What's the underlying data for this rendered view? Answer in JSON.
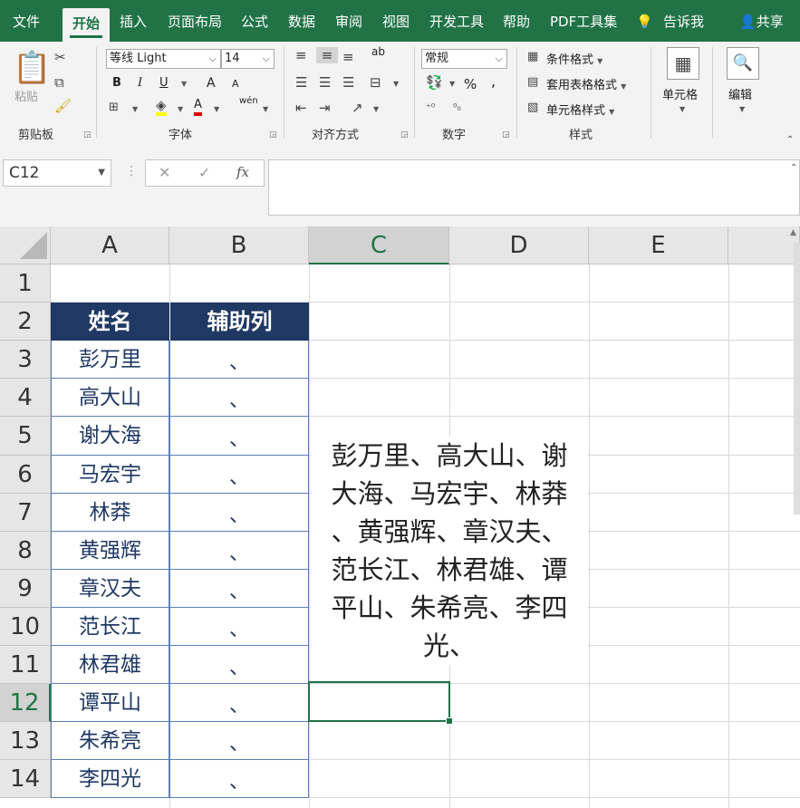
{
  "tabs": [
    {
      "label": "文件",
      "x": 14
    },
    {
      "label": "开始",
      "active": true
    },
    {
      "label": "插入"
    },
    {
      "label": "页面布局"
    },
    {
      "label": "公式"
    },
    {
      "label": "数据"
    },
    {
      "label": "审阅"
    },
    {
      "label": "视图"
    },
    {
      "label": "开发工具"
    },
    {
      "label": "帮助"
    },
    {
      "label": "PDF工具集"
    },
    {
      "label": "告诉我"
    },
    {
      "label": "共享"
    }
  ],
  "ribbon": {
    "clipboard": {
      "paste": "粘贴",
      "group": "剪贴板"
    },
    "font": {
      "name": "等线 Light",
      "size": "14",
      "bold": "B",
      "italic": "I",
      "underline": "U",
      "grow": "A",
      "shrink": "A",
      "phonetic": "wén",
      "group": "字体"
    },
    "alignment": {
      "group": "对齐方式",
      "wrap": "ab"
    },
    "number": {
      "format": "常规",
      "percent": "%",
      "comma": ",",
      "group": "数字"
    },
    "styles": {
      "conditional": "条件格式",
      "table": "套用表格格式",
      "cell": "单元格样式",
      "group": "样式"
    },
    "cells": {
      "label": "单元格"
    },
    "editing": {
      "label": "编辑"
    }
  },
  "formula_bar": {
    "name_box": "C12",
    "cancel": "✕",
    "enter": "✓",
    "fx": "fx",
    "content": ""
  },
  "columns": [
    "A",
    "B",
    "C",
    "D",
    "E"
  ],
  "rows": [
    "1",
    "2",
    "3",
    "4",
    "5",
    "6",
    "7",
    "8",
    "9",
    "10",
    "11",
    "12",
    "13",
    "14"
  ],
  "selected": {
    "column": "C",
    "row": "12"
  },
  "table": {
    "headers": [
      "姓名",
      "辅助列"
    ],
    "names": [
      "彭万里",
      "高大山",
      "谢大海",
      "马宏宇",
      "林莽",
      "黄强辉",
      "章汉夫",
      "范长江",
      "林君雄",
      "谭平山",
      "朱希亮",
      "李四光"
    ],
    "aux": [
      "、",
      "、",
      "、",
      "、",
      "、",
      "、",
      "、",
      "、",
      "、",
      "、",
      "、",
      "、"
    ]
  },
  "merged_cell_text": [
    "彭万里、高大山、谢",
    "大海、马宏宇、林莽",
    "、黄强辉、章汉夫、",
    "范长江、林君雄、谭",
    "平山、朱希亮、李四",
    "光、"
  ]
}
